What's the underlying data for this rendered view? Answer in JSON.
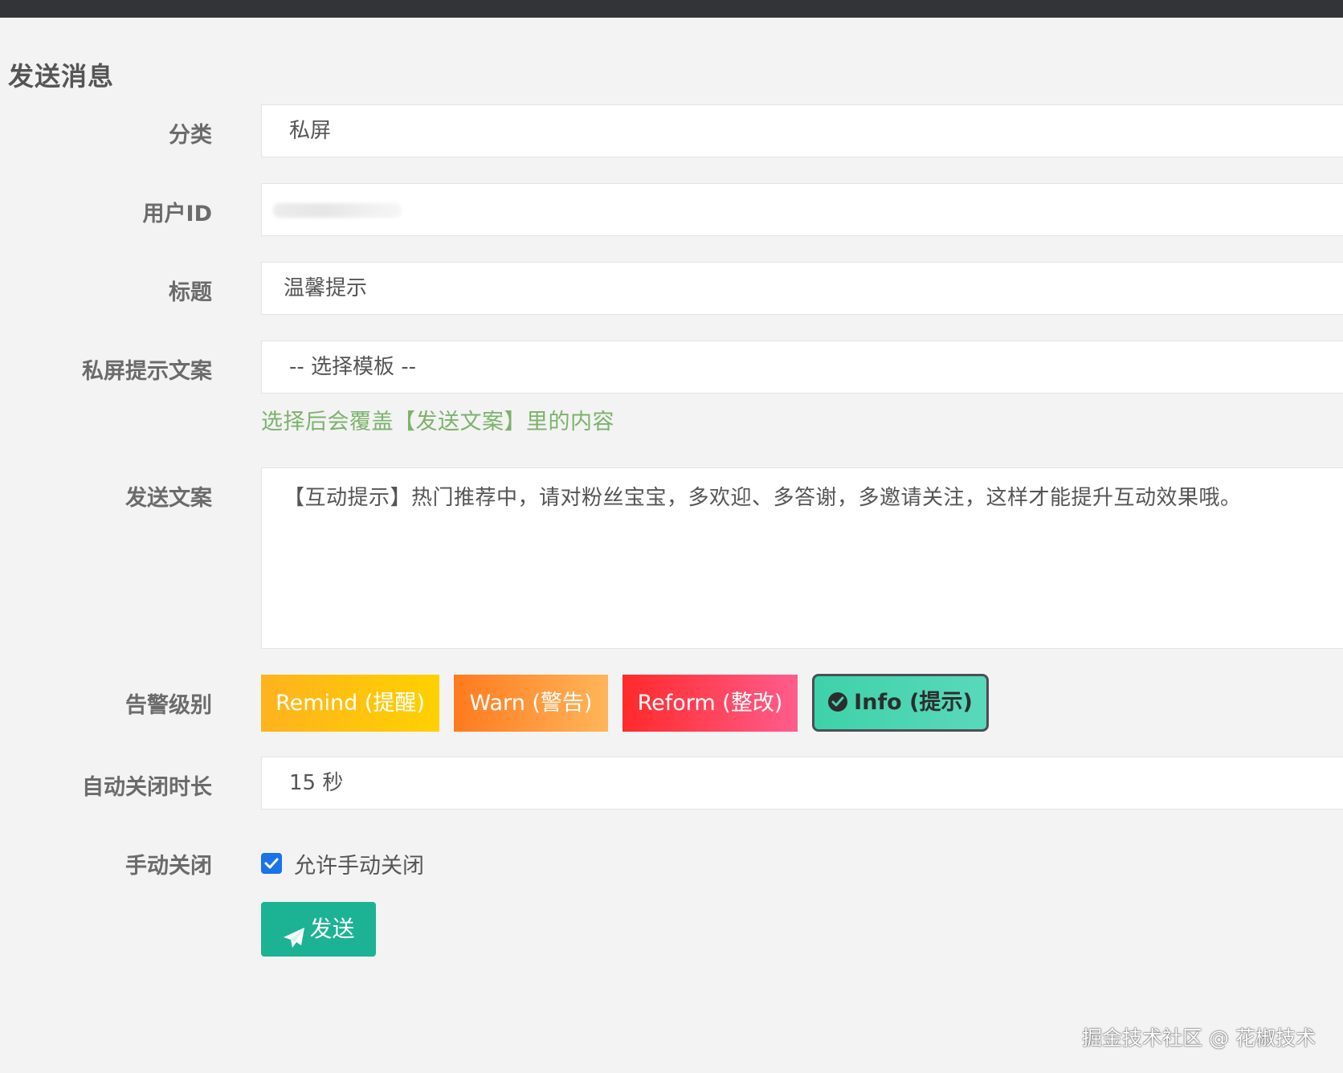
{
  "page": {
    "title": "发送消息"
  },
  "form": {
    "category": {
      "label": "分类",
      "value": "私屏"
    },
    "user_id": {
      "label": "用户ID"
    },
    "subject": {
      "label": "标题",
      "value": "温馨提示"
    },
    "template": {
      "label": "私屏提示文案",
      "value": "-- 选择模板 --",
      "hint": "选择后会覆盖【发送文案】里的内容"
    },
    "message": {
      "label": "发送文案",
      "value": "【互动提示】热门推荐中，请对粉丝宝宝，多欢迎、多答谢，多邀请关注，这样才能提升互动效果哦。"
    },
    "alert_level": {
      "label": "告警级别",
      "options": [
        {
          "label": "Remind (提醒)",
          "color": "#ffc20e"
        },
        {
          "label": "Warn (警告)",
          "color": "#ff9a3c"
        },
        {
          "label": "Reform (整改)",
          "color": "#ff3d5c"
        },
        {
          "label": "Info (提示)",
          "color": "#46d4b0",
          "selected": true
        }
      ]
    },
    "auto_close": {
      "label": "自动关闭时长",
      "value": "15 秒"
    },
    "manual_close": {
      "label": "手动关闭",
      "checkbox_label": "允许手动关闭",
      "checked": true
    },
    "submit": {
      "label": "发送",
      "icon": "paper-plane-icon",
      "color": "#1cb394"
    }
  },
  "watermark": "掘金技术社区 @ 花椒技术"
}
